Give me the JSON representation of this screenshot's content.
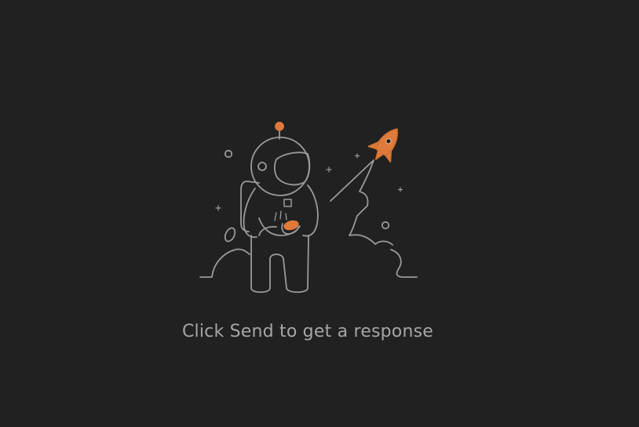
{
  "empty_state": {
    "illustration_icon": "astronaut-rocket-icon",
    "message": "Click Send to get a response"
  },
  "colors": {
    "background": "#212121",
    "line": "#9a9a9a",
    "accent": "#e07a3c",
    "text": "#a6a6a6"
  }
}
